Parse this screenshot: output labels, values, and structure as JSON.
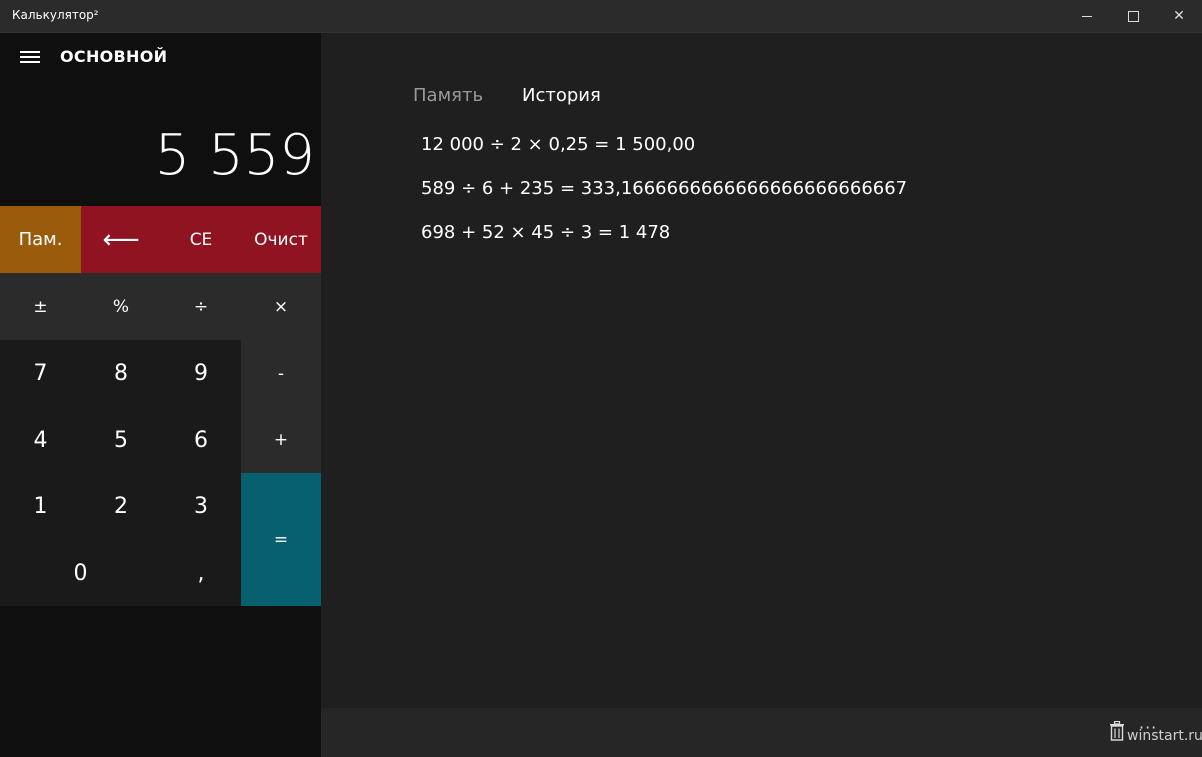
{
  "window": {
    "title": "Калькулятор²",
    "minimize_icon": "minimize-icon",
    "maximize_icon": "maximize-icon",
    "close_icon": "close-icon"
  },
  "header": {
    "menu_icon": "hamburger-menu-icon",
    "mode": "ОСНОВНОЙ"
  },
  "display": {
    "value": "5 559"
  },
  "keys": {
    "memory": "Пам.",
    "backspace": "⟵",
    "ce": "CE",
    "clear": "Очист",
    "plusminus": "±",
    "percent": "%",
    "divide": "÷",
    "multiply": "×",
    "seven": "7",
    "eight": "8",
    "nine": "9",
    "minus": "-",
    "four": "4",
    "five": "5",
    "six": "6",
    "plus": "+",
    "one": "1",
    "two": "2",
    "three": "3",
    "equals": "=",
    "zero": "0",
    "comma": ","
  },
  "tabs": {
    "memory": "Память",
    "history": "История"
  },
  "history": [
    "12 000 ÷ 2 × 0,25 = 1 500,00",
    "589 ÷ 6 + 235 = 333,1666666666666666666666667",
    "698 + 52 × 45 ÷ 3 = 1 478"
  ],
  "bottom": {
    "trash_icon": "trash-icon",
    "more": "···",
    "watermark": "winstart.ru"
  },
  "colors": {
    "memory_key": "#9a5c0c",
    "clear_keys": "#8f1321",
    "equals_key": "#07606e"
  }
}
